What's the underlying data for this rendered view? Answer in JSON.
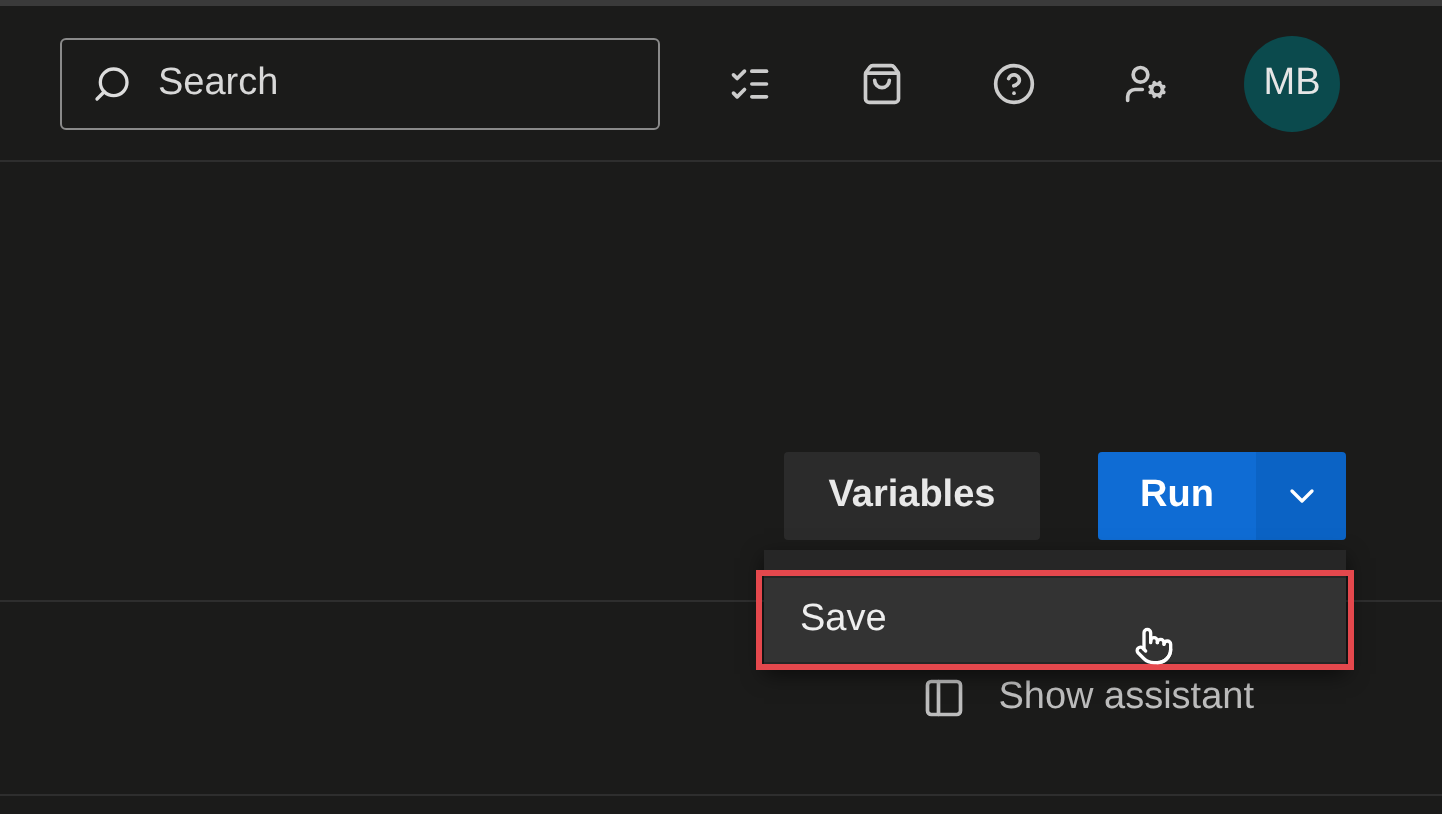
{
  "header": {
    "search": {
      "placeholder": "Search"
    },
    "avatar": {
      "initials": "MB"
    }
  },
  "toolbar": {
    "variables_button": "Variables",
    "run_button": "Run"
  },
  "run_menu": {
    "expanded": true,
    "items": [
      {
        "label": "Save",
        "highlighted": true
      }
    ]
  },
  "assistant_button": "Show assistant"
}
